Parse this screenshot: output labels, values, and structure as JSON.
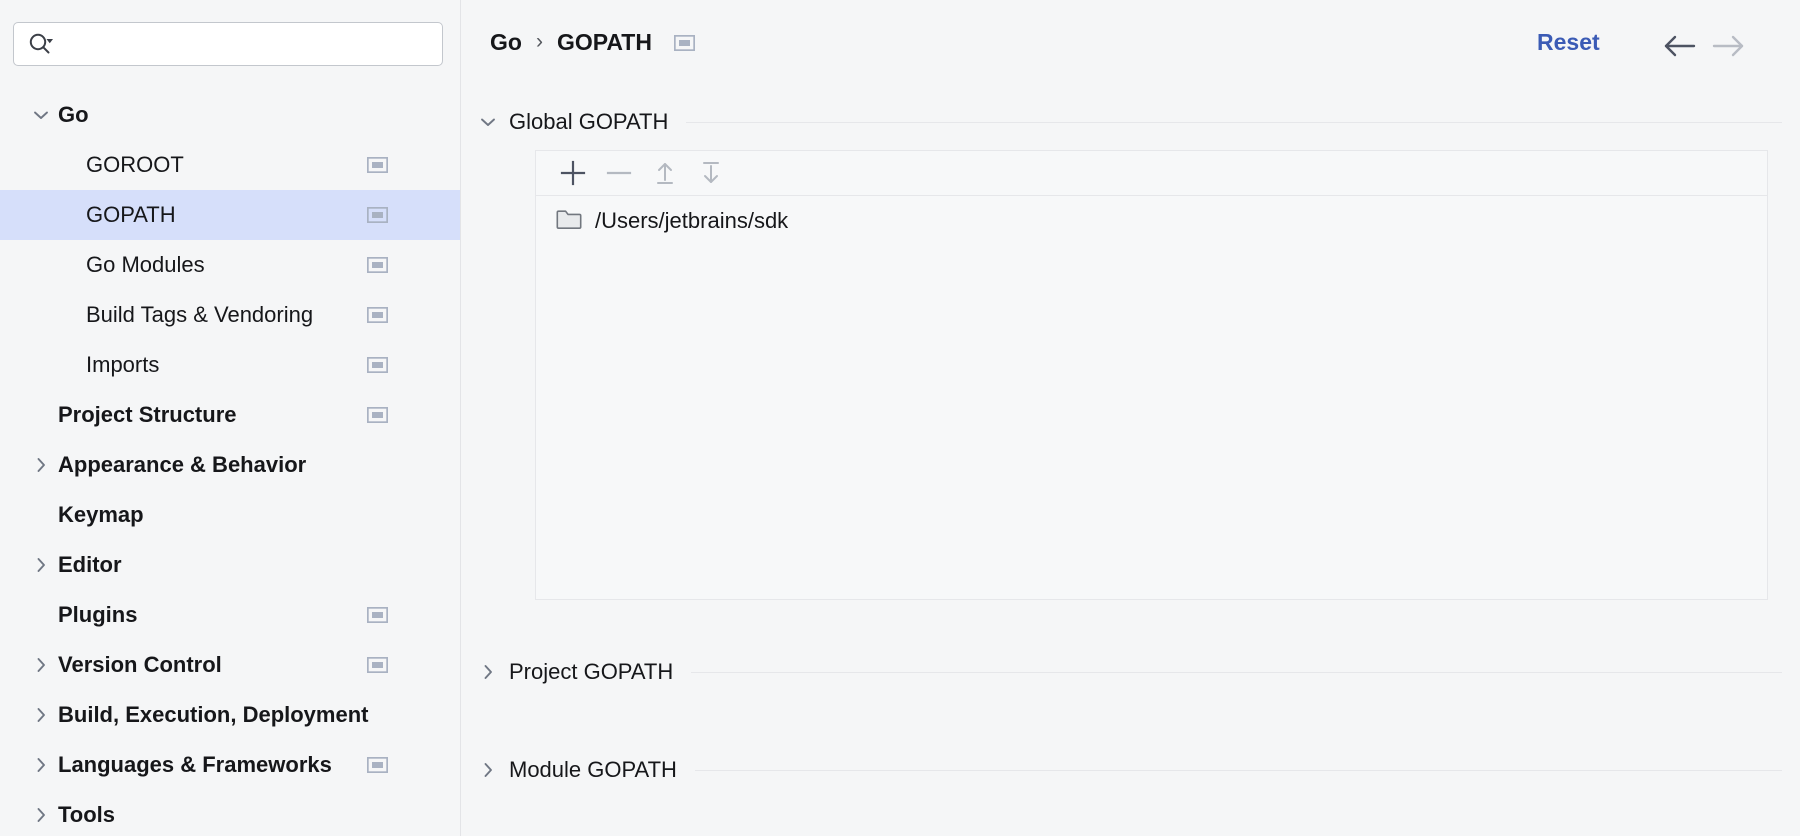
{
  "window": {
    "background_color": "#f5f6f7",
    "accent_color": "#3b5bb5",
    "selection_color": "#d6dffa"
  },
  "search": {
    "placeholder": "",
    "value": "",
    "icon": "search-icon"
  },
  "sidebar": {
    "items": [
      {
        "label": "Go",
        "level": 0,
        "expanded": true,
        "arrow": "chevron-down",
        "selected": false,
        "scope_icon": false
      },
      {
        "label": "GOROOT",
        "level": 1,
        "expanded": null,
        "arrow": "none",
        "selected": false,
        "scope_icon": true
      },
      {
        "label": "GOPATH",
        "level": 1,
        "expanded": null,
        "arrow": "none",
        "selected": true,
        "scope_icon": true
      },
      {
        "label": "Go Modules",
        "level": 1,
        "expanded": null,
        "arrow": "none",
        "selected": false,
        "scope_icon": true
      },
      {
        "label": "Build Tags & Vendoring",
        "level": 1,
        "expanded": null,
        "arrow": "none",
        "selected": false,
        "scope_icon": true
      },
      {
        "label": "Imports",
        "level": 1,
        "expanded": null,
        "arrow": "none",
        "selected": false,
        "scope_icon": true
      },
      {
        "label": "Project Structure",
        "level": 0,
        "expanded": null,
        "arrow": "none",
        "selected": false,
        "scope_icon": true
      },
      {
        "label": "Appearance & Behavior",
        "level": 0,
        "expanded": false,
        "arrow": "chevron-right",
        "selected": false,
        "scope_icon": false
      },
      {
        "label": "Keymap",
        "level": 0,
        "expanded": null,
        "arrow": "none",
        "selected": false,
        "scope_icon": false
      },
      {
        "label": "Editor",
        "level": 0,
        "expanded": false,
        "arrow": "chevron-right",
        "selected": false,
        "scope_icon": false
      },
      {
        "label": "Plugins",
        "level": 0,
        "expanded": null,
        "arrow": "none",
        "selected": false,
        "scope_icon": true
      },
      {
        "label": "Version Control",
        "level": 0,
        "expanded": false,
        "arrow": "chevron-right",
        "selected": false,
        "scope_icon": true
      },
      {
        "label": "Build, Execution, Deployment",
        "level": 0,
        "expanded": false,
        "arrow": "chevron-right",
        "selected": false,
        "scope_icon": false
      },
      {
        "label": "Languages & Frameworks",
        "level": 0,
        "expanded": false,
        "arrow": "chevron-right",
        "selected": false,
        "scope_icon": true
      },
      {
        "label": "Tools",
        "level": 0,
        "expanded": false,
        "arrow": "chevron-right",
        "selected": false,
        "scope_icon": false
      }
    ]
  },
  "header": {
    "breadcrumb": {
      "root": "Go",
      "separator": "›",
      "current": "GOPATH"
    },
    "reset_label": "Reset",
    "back_enabled": true,
    "forward_enabled": false
  },
  "sections": [
    {
      "title": "Global GOPATH",
      "expanded": true,
      "arrow": "chevron-down",
      "toolbar": [
        {
          "name": "add-button",
          "glyph": "plus",
          "enabled": true
        },
        {
          "name": "remove-button",
          "glyph": "minus",
          "enabled": false
        },
        {
          "name": "move-up-button",
          "glyph": "arrow-up-bar",
          "enabled": false
        },
        {
          "name": "move-down-button",
          "glyph": "arrow-down-bar",
          "enabled": false
        }
      ],
      "entries": [
        {
          "path": "/Users/jetbrains/sdk",
          "icon": "folder-icon"
        }
      ]
    },
    {
      "title": "Project GOPATH",
      "expanded": false,
      "arrow": "chevron-right",
      "toolbar": [],
      "entries": []
    },
    {
      "title": "Module GOPATH",
      "expanded": false,
      "arrow": "chevron-right",
      "toolbar": [],
      "entries": []
    }
  ]
}
